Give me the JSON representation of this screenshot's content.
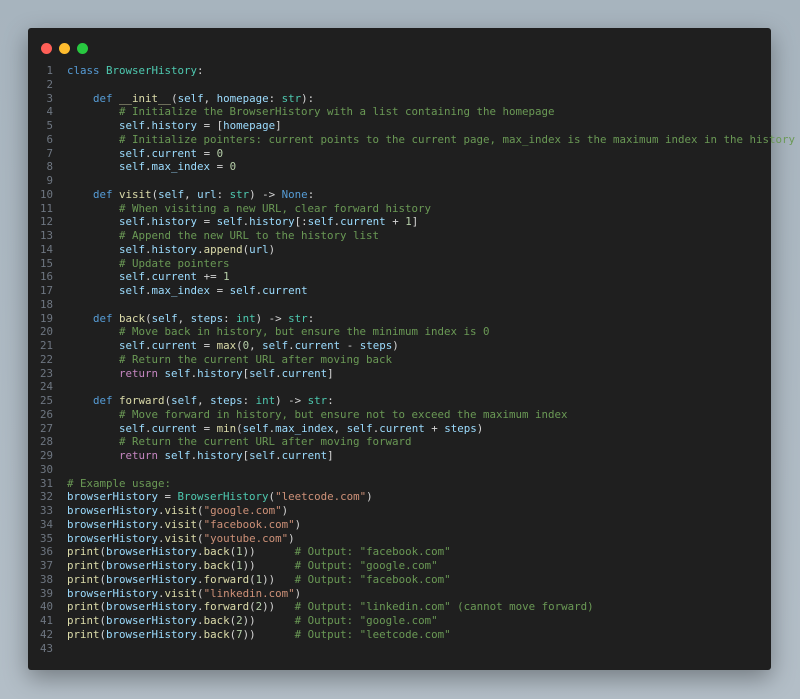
{
  "window": {
    "controls": [
      "close",
      "minimize",
      "maximize"
    ]
  },
  "colors": {
    "keyword": "#569cd6",
    "class": "#4ec9b0",
    "function": "#dcdcaa",
    "variable": "#9cdcfe",
    "string": "#ce9178",
    "comment": "#6a9955",
    "number": "#b5cea8",
    "control": "#c586c0"
  },
  "lines": [
    [
      [
        "k",
        "class"
      ],
      [
        "p",
        " "
      ],
      [
        "c",
        "BrowserHistory"
      ],
      [
        "p",
        ":"
      ]
    ],
    [],
    [
      [
        "p",
        "    "
      ],
      [
        "k",
        "def"
      ],
      [
        "p",
        " "
      ],
      [
        "f",
        "__init__"
      ],
      [
        "p",
        "("
      ],
      [
        "v",
        "self"
      ],
      [
        "p",
        ", "
      ],
      [
        "v",
        "homepage"
      ],
      [
        "p",
        ": "
      ],
      [
        "c",
        "str"
      ],
      [
        "p",
        "):"
      ]
    ],
    [
      [
        "p",
        "        "
      ],
      [
        "cm",
        "# Initialize the BrowserHistory with a list containing the homepage"
      ]
    ],
    [
      [
        "p",
        "        "
      ],
      [
        "v",
        "self"
      ],
      [
        "p",
        "."
      ],
      [
        "v",
        "history"
      ],
      [
        "p",
        " = ["
      ],
      [
        "v",
        "homepage"
      ],
      [
        "p",
        "]"
      ]
    ],
    [
      [
        "p",
        "        "
      ],
      [
        "cm",
        "# Initialize pointers: current points to the current page, max_index is the maximum index in the history"
      ]
    ],
    [
      [
        "p",
        "        "
      ],
      [
        "v",
        "self"
      ],
      [
        "p",
        "."
      ],
      [
        "v",
        "current"
      ],
      [
        "p",
        " = "
      ],
      [
        "n",
        "0"
      ]
    ],
    [
      [
        "p",
        "        "
      ],
      [
        "v",
        "self"
      ],
      [
        "p",
        "."
      ],
      [
        "v",
        "max_index"
      ],
      [
        "p",
        " = "
      ],
      [
        "n",
        "0"
      ]
    ],
    [],
    [
      [
        "p",
        "    "
      ],
      [
        "k",
        "def"
      ],
      [
        "p",
        " "
      ],
      [
        "f",
        "visit"
      ],
      [
        "p",
        "("
      ],
      [
        "v",
        "self"
      ],
      [
        "p",
        ", "
      ],
      [
        "v",
        "url"
      ],
      [
        "p",
        ": "
      ],
      [
        "c",
        "str"
      ],
      [
        "p",
        ") -> "
      ],
      [
        "k",
        "None"
      ],
      [
        "p",
        ":"
      ]
    ],
    [
      [
        "p",
        "        "
      ],
      [
        "cm",
        "# When visiting a new URL, clear forward history"
      ]
    ],
    [
      [
        "p",
        "        "
      ],
      [
        "v",
        "self"
      ],
      [
        "p",
        "."
      ],
      [
        "v",
        "history"
      ],
      [
        "p",
        " = "
      ],
      [
        "v",
        "self"
      ],
      [
        "p",
        "."
      ],
      [
        "v",
        "history"
      ],
      [
        "p",
        "[:"
      ],
      [
        "v",
        "self"
      ],
      [
        "p",
        "."
      ],
      [
        "v",
        "current"
      ],
      [
        "p",
        " + "
      ],
      [
        "n",
        "1"
      ],
      [
        "p",
        "]"
      ]
    ],
    [
      [
        "p",
        "        "
      ],
      [
        "cm",
        "# Append the new URL to the history list"
      ]
    ],
    [
      [
        "p",
        "        "
      ],
      [
        "v",
        "self"
      ],
      [
        "p",
        "."
      ],
      [
        "v",
        "history"
      ],
      [
        "p",
        "."
      ],
      [
        "f",
        "append"
      ],
      [
        "p",
        "("
      ],
      [
        "v",
        "url"
      ],
      [
        "p",
        ")"
      ]
    ],
    [
      [
        "p",
        "        "
      ],
      [
        "cm",
        "# Update pointers"
      ]
    ],
    [
      [
        "p",
        "        "
      ],
      [
        "v",
        "self"
      ],
      [
        "p",
        "."
      ],
      [
        "v",
        "current"
      ],
      [
        "p",
        " += "
      ],
      [
        "n",
        "1"
      ]
    ],
    [
      [
        "p",
        "        "
      ],
      [
        "v",
        "self"
      ],
      [
        "p",
        "."
      ],
      [
        "v",
        "max_index"
      ],
      [
        "p",
        " = "
      ],
      [
        "v",
        "self"
      ],
      [
        "p",
        "."
      ],
      [
        "v",
        "current"
      ]
    ],
    [],
    [
      [
        "p",
        "    "
      ],
      [
        "k",
        "def"
      ],
      [
        "p",
        " "
      ],
      [
        "f",
        "back"
      ],
      [
        "p",
        "("
      ],
      [
        "v",
        "self"
      ],
      [
        "p",
        ", "
      ],
      [
        "v",
        "steps"
      ],
      [
        "p",
        ": "
      ],
      [
        "c",
        "int"
      ],
      [
        "p",
        ") -> "
      ],
      [
        "c",
        "str"
      ],
      [
        "p",
        ":"
      ]
    ],
    [
      [
        "p",
        "        "
      ],
      [
        "cm",
        "# Move back in history, but ensure the minimum index is 0"
      ]
    ],
    [
      [
        "p",
        "        "
      ],
      [
        "v",
        "self"
      ],
      [
        "p",
        "."
      ],
      [
        "v",
        "current"
      ],
      [
        "p",
        " = "
      ],
      [
        "f",
        "max"
      ],
      [
        "p",
        "("
      ],
      [
        "n",
        "0"
      ],
      [
        "p",
        ", "
      ],
      [
        "v",
        "self"
      ],
      [
        "p",
        "."
      ],
      [
        "v",
        "current"
      ],
      [
        "p",
        " - "
      ],
      [
        "v",
        "steps"
      ],
      [
        "p",
        ")"
      ]
    ],
    [
      [
        "p",
        "        "
      ],
      [
        "cm",
        "# Return the current URL after moving back"
      ]
    ],
    [
      [
        "p",
        "        "
      ],
      [
        "r",
        "return"
      ],
      [
        "p",
        " "
      ],
      [
        "v",
        "self"
      ],
      [
        "p",
        "."
      ],
      [
        "v",
        "history"
      ],
      [
        "p",
        "["
      ],
      [
        "v",
        "self"
      ],
      [
        "p",
        "."
      ],
      [
        "v",
        "current"
      ],
      [
        "p",
        "]"
      ]
    ],
    [],
    [
      [
        "p",
        "    "
      ],
      [
        "k",
        "def"
      ],
      [
        "p",
        " "
      ],
      [
        "f",
        "forward"
      ],
      [
        "p",
        "("
      ],
      [
        "v",
        "self"
      ],
      [
        "p",
        ", "
      ],
      [
        "v",
        "steps"
      ],
      [
        "p",
        ": "
      ],
      [
        "c",
        "int"
      ],
      [
        "p",
        ") -> "
      ],
      [
        "c",
        "str"
      ],
      [
        "p",
        ":"
      ]
    ],
    [
      [
        "p",
        "        "
      ],
      [
        "cm",
        "# Move forward in history, but ensure not to exceed the maximum index"
      ]
    ],
    [
      [
        "p",
        "        "
      ],
      [
        "v",
        "self"
      ],
      [
        "p",
        "."
      ],
      [
        "v",
        "current"
      ],
      [
        "p",
        " = "
      ],
      [
        "f",
        "min"
      ],
      [
        "p",
        "("
      ],
      [
        "v",
        "self"
      ],
      [
        "p",
        "."
      ],
      [
        "v",
        "max_index"
      ],
      [
        "p",
        ", "
      ],
      [
        "v",
        "self"
      ],
      [
        "p",
        "."
      ],
      [
        "v",
        "current"
      ],
      [
        "p",
        " + "
      ],
      [
        "v",
        "steps"
      ],
      [
        "p",
        ")"
      ]
    ],
    [
      [
        "p",
        "        "
      ],
      [
        "cm",
        "# Return the current URL after moving forward"
      ]
    ],
    [
      [
        "p",
        "        "
      ],
      [
        "r",
        "return"
      ],
      [
        "p",
        " "
      ],
      [
        "v",
        "self"
      ],
      [
        "p",
        "."
      ],
      [
        "v",
        "history"
      ],
      [
        "p",
        "["
      ],
      [
        "v",
        "self"
      ],
      [
        "p",
        "."
      ],
      [
        "v",
        "current"
      ],
      [
        "p",
        "]"
      ]
    ],
    [],
    [
      [
        "cm",
        "# Example usage:"
      ]
    ],
    [
      [
        "v",
        "browserHistory"
      ],
      [
        "p",
        " = "
      ],
      [
        "c",
        "BrowserHistory"
      ],
      [
        "p",
        "("
      ],
      [
        "s",
        "\"leetcode.com\""
      ],
      [
        "p",
        ")"
      ]
    ],
    [
      [
        "v",
        "browserHistory"
      ],
      [
        "p",
        "."
      ],
      [
        "f",
        "visit"
      ],
      [
        "p",
        "("
      ],
      [
        "s",
        "\"google.com\""
      ],
      [
        "p",
        ")"
      ]
    ],
    [
      [
        "v",
        "browserHistory"
      ],
      [
        "p",
        "."
      ],
      [
        "f",
        "visit"
      ],
      [
        "p",
        "("
      ],
      [
        "s",
        "\"facebook.com\""
      ],
      [
        "p",
        ")"
      ]
    ],
    [
      [
        "v",
        "browserHistory"
      ],
      [
        "p",
        "."
      ],
      [
        "f",
        "visit"
      ],
      [
        "p",
        "("
      ],
      [
        "s",
        "\"youtube.com\""
      ],
      [
        "p",
        ")"
      ]
    ],
    [
      [
        "f",
        "print"
      ],
      [
        "p",
        "("
      ],
      [
        "v",
        "browserHistory"
      ],
      [
        "p",
        "."
      ],
      [
        "f",
        "back"
      ],
      [
        "p",
        "("
      ],
      [
        "n",
        "1"
      ],
      [
        "p",
        "))      "
      ],
      [
        "cm",
        "# Output: \"facebook.com\""
      ]
    ],
    [
      [
        "f",
        "print"
      ],
      [
        "p",
        "("
      ],
      [
        "v",
        "browserHistory"
      ],
      [
        "p",
        "."
      ],
      [
        "f",
        "back"
      ],
      [
        "p",
        "("
      ],
      [
        "n",
        "1"
      ],
      [
        "p",
        "))      "
      ],
      [
        "cm",
        "# Output: \"google.com\""
      ]
    ],
    [
      [
        "f",
        "print"
      ],
      [
        "p",
        "("
      ],
      [
        "v",
        "browserHistory"
      ],
      [
        "p",
        "."
      ],
      [
        "f",
        "forward"
      ],
      [
        "p",
        "("
      ],
      [
        "n",
        "1"
      ],
      [
        "p",
        "))   "
      ],
      [
        "cm",
        "# Output: \"facebook.com\""
      ]
    ],
    [
      [
        "v",
        "browserHistory"
      ],
      [
        "p",
        "."
      ],
      [
        "f",
        "visit"
      ],
      [
        "p",
        "("
      ],
      [
        "s",
        "\"linkedin.com\""
      ],
      [
        "p",
        ")"
      ]
    ],
    [
      [
        "f",
        "print"
      ],
      [
        "p",
        "("
      ],
      [
        "v",
        "browserHistory"
      ],
      [
        "p",
        "."
      ],
      [
        "f",
        "forward"
      ],
      [
        "p",
        "("
      ],
      [
        "n",
        "2"
      ],
      [
        "p",
        "))   "
      ],
      [
        "cm",
        "# Output: \"linkedin.com\" (cannot move forward)"
      ]
    ],
    [
      [
        "f",
        "print"
      ],
      [
        "p",
        "("
      ],
      [
        "v",
        "browserHistory"
      ],
      [
        "p",
        "."
      ],
      [
        "f",
        "back"
      ],
      [
        "p",
        "("
      ],
      [
        "n",
        "2"
      ],
      [
        "p",
        "))      "
      ],
      [
        "cm",
        "# Output: \"google.com\""
      ]
    ],
    [
      [
        "f",
        "print"
      ],
      [
        "p",
        "("
      ],
      [
        "v",
        "browserHistory"
      ],
      [
        "p",
        "."
      ],
      [
        "f",
        "back"
      ],
      [
        "p",
        "("
      ],
      [
        "n",
        "7"
      ],
      [
        "p",
        "))      "
      ],
      [
        "cm",
        "# Output: \"leetcode.com\""
      ]
    ],
    []
  ]
}
